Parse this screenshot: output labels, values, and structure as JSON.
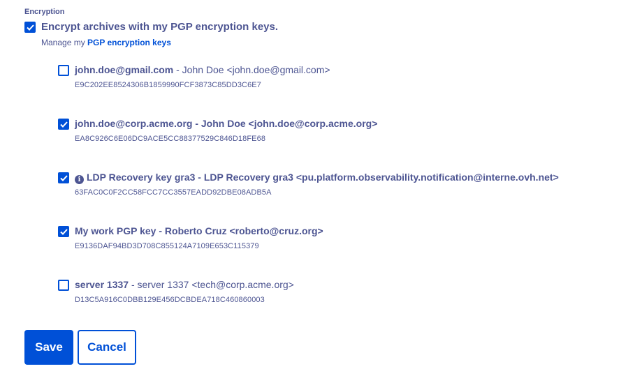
{
  "section": {
    "label": "Encryption"
  },
  "encrypt_option": {
    "checked": true,
    "label": "Encrypt archives with my PGP encryption keys.",
    "manage_prefix": "Manage my",
    "manage_link": "PGP encryption keys"
  },
  "keys": [
    {
      "checked": false,
      "bold_name": "john.doe@gmail.com",
      "rest": " - John Doe <john.doe@gmail.com>",
      "info_icon": false,
      "fingerprint": "E9C202EE8524306B1859990FCF3873C85DD3C6E7"
    },
    {
      "checked": true,
      "bold_name": "john.doe@corp.acme.org - John Doe <john.doe@corp.acme.org>",
      "rest": "",
      "info_icon": false,
      "fingerprint": "EA8C926C6E06DC9ACE5CC88377529C846D18FE68"
    },
    {
      "checked": true,
      "bold_name": "LDP Recovery key gra3 - LDP Recovery gra3 <pu.platform.observability.notification@interne.ovh.net>",
      "rest": "",
      "info_icon": true,
      "fingerprint": "63FAC0C0F2CC58FCC7CC3557EADD92DBE08ADB5A"
    },
    {
      "checked": true,
      "bold_name": "My work PGP key - Roberto Cruz <roberto@cruz.org>",
      "rest": "",
      "info_icon": false,
      "fingerprint": "E9136DAF94BD3D708C855124A7109E653C115379"
    },
    {
      "checked": false,
      "bold_name": "server 1337",
      "rest": " - server 1337 <tech@corp.acme.org>",
      "info_icon": false,
      "fingerprint": "D13C5A916C0DBB129E456DCBDEA718C460860003"
    }
  ],
  "actions": {
    "save_label": "Save",
    "cancel_label": "Cancel"
  },
  "colors": {
    "primary": "#0050d7",
    "text": "#4d5592"
  }
}
